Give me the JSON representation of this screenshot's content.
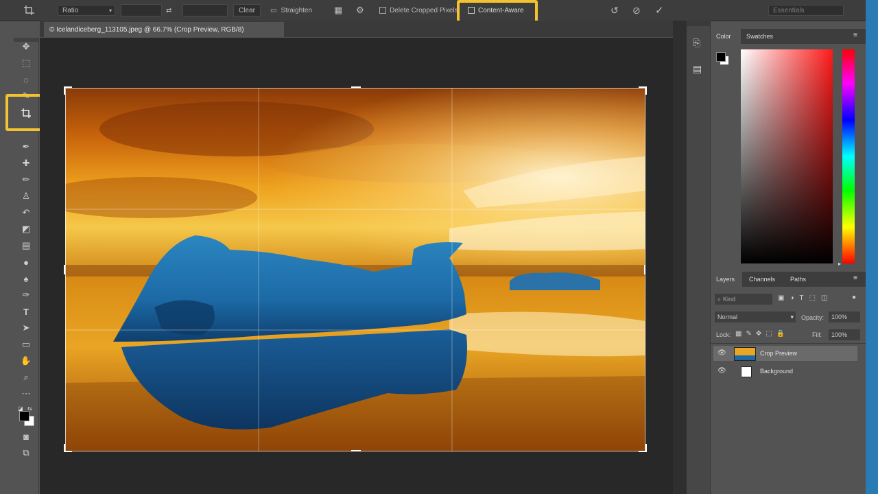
{
  "options_bar": {
    "ratio_label": "Ratio",
    "clear_label": "Clear",
    "straighten_label": "Straighten",
    "delete_cropped_label": "Delete Cropped Pixels",
    "content_aware_label": "Content-Aware",
    "search_placeholder": "Essentials"
  },
  "document_tab": {
    "title": "© Icelandiceberg_113105.jpeg @ 66.7% (Crop Preview, RGB/8)"
  },
  "color_panel": {
    "tabs": [
      "Color",
      "Swatches"
    ]
  },
  "layers_panel": {
    "tabs": [
      "Layers",
      "Channels",
      "Paths"
    ],
    "kind_label": "Kind",
    "blend_mode": "Normal",
    "opacity_label": "Opacity:",
    "opacity_value": "100%",
    "lock_label": "Lock:",
    "fill_label": "Fill:",
    "fill_value": "100%",
    "layers": [
      {
        "name": "Crop Preview",
        "selected": true
      },
      {
        "name": "Background",
        "selected": false
      }
    ]
  },
  "highlight_color": "#f2c230"
}
